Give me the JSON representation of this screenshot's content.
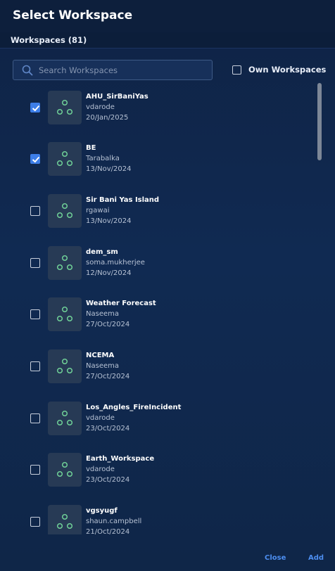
{
  "dialog": {
    "title": "Select Workspace"
  },
  "section": {
    "title": "Workspaces (81)"
  },
  "search": {
    "placeholder": "Search Workspaces",
    "value": ""
  },
  "filter": {
    "own_workspaces_label": "Own Workspaces",
    "own_workspaces_checked": false
  },
  "workspaces": [
    {
      "name": "AHU_SirBaniYas",
      "owner": "vdarode",
      "date": "20/Jan/2025",
      "selected": true,
      "icon": "workspace-nodes-icon"
    },
    {
      "name": "BE",
      "owner": "Tarabalka",
      "date": "13/Nov/2024",
      "selected": true,
      "icon": "workspace-nodes-icon"
    },
    {
      "name": "Sir Bani Yas Island",
      "owner": "rgawai",
      "date": "13/Nov/2024",
      "selected": false,
      "icon": "workspace-nodes-icon"
    },
    {
      "name": "dem_sm",
      "owner": "soma.mukherjee",
      "date": "12/Nov/2024",
      "selected": false,
      "icon": "workspace-nodes-icon"
    },
    {
      "name": "Weather Forecast",
      "owner": "Naseema",
      "date": "27/Oct/2024",
      "selected": false,
      "icon": "workspace-nodes-icon"
    },
    {
      "name": "NCEMA",
      "owner": "Naseema",
      "date": "27/Oct/2024",
      "selected": false,
      "icon": "workspace-nodes-icon"
    },
    {
      "name": "Los_Angles_FireIncident",
      "owner": "vdarode",
      "date": "23/Oct/2024",
      "selected": false,
      "icon": "workspace-nodes-icon"
    },
    {
      "name": "Earth_Workspace",
      "owner": "vdarode",
      "date": "23/Oct/2024",
      "selected": false,
      "icon": "workspace-nodes-icon"
    },
    {
      "name": "vgsyugf",
      "owner": "shaun.campbell",
      "date": "21/Oct/2024",
      "selected": false,
      "icon": "workspace-nodes-icon"
    }
  ],
  "footer": {
    "close_label": "Close",
    "add_label": "Add"
  },
  "colors": {
    "accent": "#3d7ee8",
    "link": "#4d8ef0",
    "icon_green": "#6fcf97",
    "background": "#0f2648"
  }
}
